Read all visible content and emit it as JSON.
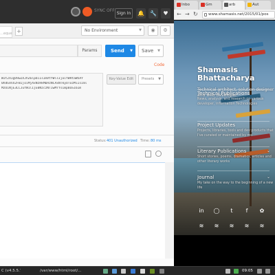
{
  "postman": {
    "sync_label": "SYNC OFF",
    "signin_label": "Sign In",
    "tab_label": "…equest",
    "tab_add": "+",
    "environment": "No Environment",
    "params_label": "Params",
    "send_label": "Send",
    "save_label": "Save",
    "code_label": "Code",
    "body_lines": [
      "WIt2XIgU9wZXJhZ6lpbiIsImVtYWlsIjoiYWRtaW5AY",
      "0hdGVnX2FBIjoiMjAxNzRkMDAzNCAxNTkyOTozMiIsIml",
      "MzU1NjE3LCJuYW1lIjE0NzczNTIwMTYsImp0aSI6Im",
      ""
    ],
    "kv_edit_label": "Key-Value Edit",
    "presets_label": "Presets",
    "status_label": "Status:",
    "status_value": "401 Unauthorized",
    "time_label": "Time:",
    "time_value": "80 ms"
  },
  "chrome": {
    "tabs": [
      {
        "label": "Inbo",
        "icon_color": "#d93025"
      },
      {
        "label": "Gm",
        "icon_color": "#d93025"
      },
      {
        "label": "arb",
        "icon_color": "#555555"
      },
      {
        "label": "Aut",
        "icon_color": "#f4b400"
      }
    ],
    "url": "www.shamasis.net/2015/01/pos"
  },
  "site": {
    "title": "Shamasis Bhattacharya",
    "subtitle": "Technical architect, solution designer and web developer",
    "sections": [
      {
        "title": "Technical Publications",
        "desc": "News, analysis, and research on various developer, information Technologies",
        "has_chevron": false
      },
      {
        "title": "Project Updates",
        "desc": "Projects, libraries, tools and dev products that I've curated or maintained by me",
        "has_chevron": false
      },
      {
        "title": "Literary Publications",
        "desc": "Short stories, poems, dramatics, articles and other literary works",
        "has_chevron": true
      },
      {
        "title": "Journal",
        "desc": "My take on the way to the beginning of a new life",
        "has_chevron": true
      }
    ],
    "social_row1": [
      "in",
      "◯",
      "t",
      "f",
      "✿"
    ],
    "social_row2": [
      "≋",
      "≋",
      "≋",
      "≋",
      "≋"
    ]
  },
  "taskbar": {
    "items": [
      {
        "label": "C (v4.5.5.7)"
      },
      {
        "label": "/var/www/html/root/..."
      }
    ],
    "clock": "09:05"
  }
}
